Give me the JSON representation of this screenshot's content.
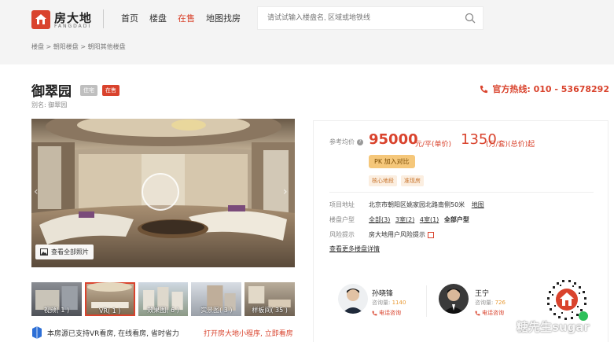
{
  "header": {
    "logo_text": "房大地",
    "logo_sub": "FANGDADI",
    "nav": [
      {
        "label": "首页",
        "active": false
      },
      {
        "label": "楼盘",
        "active": false
      },
      {
        "label": "在售",
        "active": true
      },
      {
        "label": "地图找房",
        "active": false
      }
    ],
    "search_placeholder": "请试试输入楼盘名, 区域或地铁线"
  },
  "breadcrumb": "楼盘 > 朝阳楼盘 > 朝阳其他楼盘",
  "property": {
    "title": "御翠园",
    "tag_type": "住宅",
    "tag_status": "在售",
    "alias": "别名: 御翠园",
    "hotline": "官方热线: 010 - 53678292"
  },
  "gallery": {
    "view_all": "查看全部照片",
    "thumbs": [
      {
        "label": "视频( 1 )",
        "active": false
      },
      {
        "label": "VR( 1 )",
        "active": true
      },
      {
        "label": "效果图( 6 )",
        "active": false
      },
      {
        "label": "实景图( 3 )",
        "active": false
      },
      {
        "label": "样板间( 35 )",
        "active": false
      }
    ],
    "vr_note": "本房源已支持VR看房, 在线看房, 省时省力",
    "vr_link": "打开房大地小程序, 立即看房"
  },
  "price": {
    "label": "参考均价",
    "unit_price": "95000",
    "unit_price_suffix": "元/平(单价)",
    "total_price": "1350",
    "total_price_suffix": "(万/套)(总价)起",
    "compare_button": "PK 加入对比",
    "features": [
      "核心地段",
      "准现房"
    ]
  },
  "details": {
    "address_label": "项目地址",
    "address_value": "北京市朝阳区姚家园北路南侧50米",
    "map_link": "地图",
    "layout_label": "楼盘户型",
    "layouts": [
      "全部(3)",
      "3室(2)",
      "4室(1)"
    ],
    "layouts_all": "全部户型",
    "risk_label": "风险提示",
    "risk_value": "房大地用户风险提示",
    "more_link": "查看更多楼盘详情"
  },
  "agents": [
    {
      "name": "孙晓锋",
      "count_label": "咨询量:",
      "count": "1140",
      "call": "电话咨询"
    },
    {
      "name": "王宁",
      "count_label": "咨询量:",
      "count": "726",
      "call": "电话咨询"
    }
  ],
  "watermark": "糖先生sugar",
  "colors": {
    "accent": "#d9432d",
    "compare": "#f5c77a"
  }
}
